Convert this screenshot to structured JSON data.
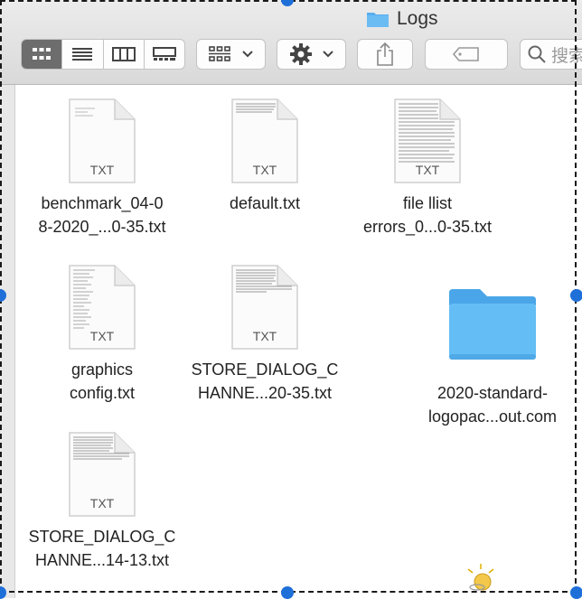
{
  "window": {
    "title": "Logs",
    "search_placeholder": "搜索"
  },
  "toolbar": {
    "view_modes": [
      "icon-view",
      "list-view",
      "column-view",
      "gallery-view"
    ],
    "active_view": "icon-view"
  },
  "files": [
    {
      "line1": "benchmark_04-0",
      "line2": "8-2020_...0-35.txt",
      "ext": "TXT"
    },
    {
      "line1": "default.txt",
      "line2": "",
      "ext": "TXT"
    },
    {
      "line1": "file llist",
      "line2": "errors_0...0-35.txt",
      "ext": "TXT"
    },
    {
      "line1": "graphics",
      "line2": "config.txt",
      "ext": "TXT"
    },
    {
      "line1": "STORE_DIALOG_C",
      "line2": "HANNE...20-35.txt",
      "ext": "TXT"
    },
    {
      "line1": "2020-standard-",
      "line2": "logopac...out.com",
      "ext": ""
    },
    {
      "line1": "STORE_DIALOG_C",
      "line2": "HANNE...14-13.txt",
      "ext": "TXT"
    }
  ],
  "colors": {
    "folder_blue": "#5ab2f0",
    "handle_blue": "#1f6fd9"
  }
}
